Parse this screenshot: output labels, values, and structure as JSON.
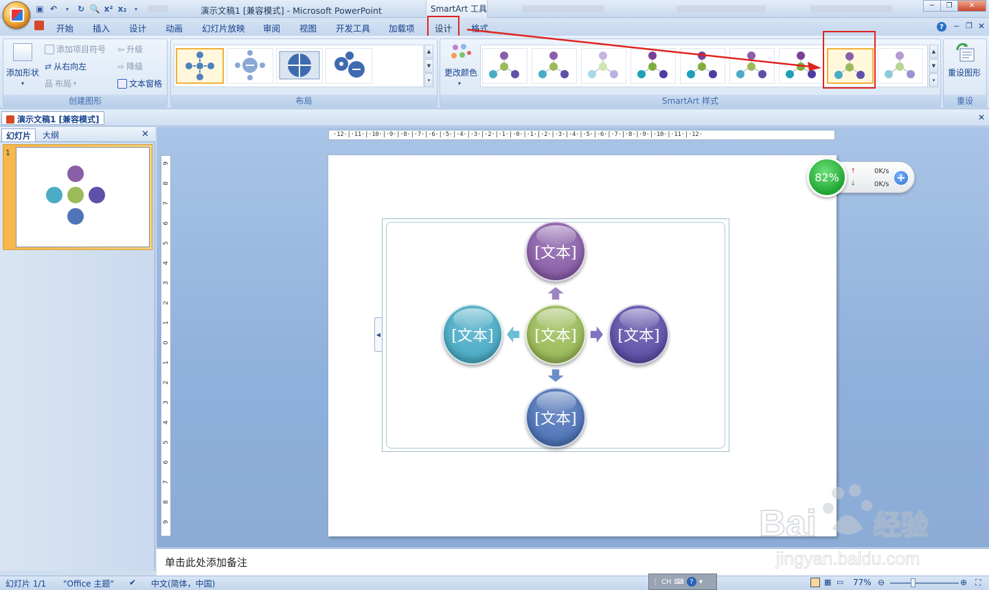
{
  "titlebar": {
    "doc_title": "演示文稿1 [兼容模式] - Microsoft PowerPoint",
    "context_title": "SmartArt 工具",
    "min": "─",
    "restore": "❐",
    "close": "✕"
  },
  "tabs": [
    "开始",
    "插入",
    "设计",
    "动画",
    "幻灯片放映",
    "审阅",
    "视图",
    "开发工具",
    "加载项",
    "设计",
    "格式"
  ],
  "ribbon": {
    "create_group": {
      "add_shape": "添加形状",
      "add_bullet": "添加项目符号",
      "right_to_left": "从右向左",
      "layout": "布局",
      "promote": "升级",
      "demote": "降级",
      "text_pane": "文本窗格",
      "label": "创建图形"
    },
    "layout_group": {
      "label": "布局"
    },
    "style_group": {
      "change_colors": "更改颜色",
      "label": "SmartArt 样式"
    },
    "reset_group": {
      "reset_graphic": "重设图形",
      "label": "重设"
    }
  },
  "document_tab": "演示文稿1 [兼容模式]",
  "left_pane": {
    "tab_slides": "幻灯片",
    "tab_outline": "大纲",
    "close": "✕",
    "slide_number": "1"
  },
  "hruler_text": "·12·|·11·|·10·|·9·|·8·|·7·|·6·|·5·|·4·|·3·|·2·|·1·|·0·|·1·|·2·|·3·|·4·|·5·|·6·|·7·|·8·|·9·|·10·|·11·|·12·",
  "vruler_labels": [
    "9",
    "8",
    "7",
    "6",
    "5",
    "4",
    "3",
    "2",
    "1",
    "0",
    "1",
    "2",
    "3",
    "4",
    "5",
    "6",
    "7",
    "8",
    "9"
  ],
  "smartart": {
    "nodes": {
      "top": "[文本]",
      "left": "[文本]",
      "center": "[文本]",
      "right": "[文本]",
      "bottom": "[文本]"
    },
    "colors": {
      "top": "#8a5fa8",
      "left": "#4bacc6",
      "center": "#9bbb59",
      "right": "#5f50a8",
      "bottom": "#4f74b8"
    }
  },
  "net_widget": {
    "percent": "82%",
    "up_speed": "0K/s",
    "down_speed": "0K/s",
    "plus": "+"
  },
  "notes_placeholder": "单击此处添加备注",
  "statusbar": {
    "slide_count": "幻灯片 1/1",
    "theme": "\"Office 主题\"",
    "language": "中文(简体，中国)",
    "zoom": "77%",
    "ime": "CH"
  },
  "watermark": {
    "brand": "Bai",
    "brand2": "经验",
    "url": "jingyan.baidu.com"
  }
}
